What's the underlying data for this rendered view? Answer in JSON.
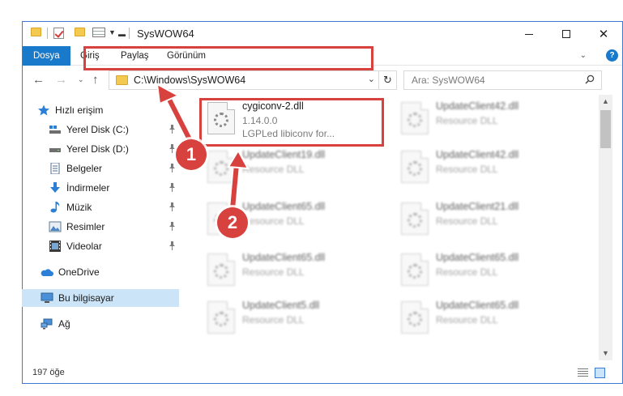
{
  "window": {
    "title": "SysWOW64",
    "minimize": "–",
    "maximize": "",
    "close": "✕"
  },
  "ribbon": {
    "tabs": [
      {
        "label": "Dosya",
        "active": true
      },
      {
        "label": "Giriş",
        "active": false
      },
      {
        "label": "Paylaş",
        "active": false
      },
      {
        "label": "Görünüm",
        "active": false
      }
    ],
    "help": "?"
  },
  "address": {
    "path": "C:\\Windows\\SysWOW64",
    "search_placeholder": "Ara: SysWOW64"
  },
  "sidebar": {
    "items": [
      {
        "label": "Hızlı erişim",
        "icon": "star-icon"
      },
      {
        "label": "Yerel Disk (C:)",
        "icon": "drive-icon"
      },
      {
        "label": "Yerel Disk (D:)",
        "icon": "drive-icon"
      },
      {
        "label": "Belgeler",
        "icon": "documents-icon"
      },
      {
        "label": "İndirmeler",
        "icon": "download-icon"
      },
      {
        "label": "Müzik",
        "icon": "music-icon"
      },
      {
        "label": "Resimler",
        "icon": "pictures-icon"
      },
      {
        "label": "Videolar",
        "icon": "videos-icon"
      },
      {
        "label": "OneDrive",
        "icon": "cloud-icon"
      },
      {
        "label": "Bu bilgisayar",
        "icon": "computer-icon"
      },
      {
        "label": "Ağ",
        "icon": "network-icon"
      }
    ]
  },
  "files": [
    {
      "name": "cygiconv-2.dll",
      "line2": "1.14.0.0",
      "line3": "LGPLed libiconv for...",
      "highlighted": true
    },
    {
      "name": "UpdateClient42.dll",
      "line2": "Resource DLL"
    },
    {
      "name": "UpdateClient19.dll",
      "line2": "Resource DLL"
    },
    {
      "name": "UpdateClient42.dll",
      "line2": "Resource DLL"
    },
    {
      "name": "UpdateClient65.dll",
      "line2": "Resource DLL"
    },
    {
      "name": "UpdateClient21.dll",
      "line2": "Resource DLL"
    },
    {
      "name": "UpdateClient65.dll",
      "line2": "Resource DLL"
    },
    {
      "name": "UpdateClient65.dll",
      "line2": "Resource DLL"
    },
    {
      "name": "UpdateClient5.dll",
      "line2": "Resource DLL"
    },
    {
      "name": "UpdateClient65.dll",
      "line2": "Resource DLL"
    }
  ],
  "status": {
    "item_count": "197 öğe"
  },
  "annotations": {
    "step1": "1",
    "step2": "2",
    "color": "#d7413e"
  }
}
